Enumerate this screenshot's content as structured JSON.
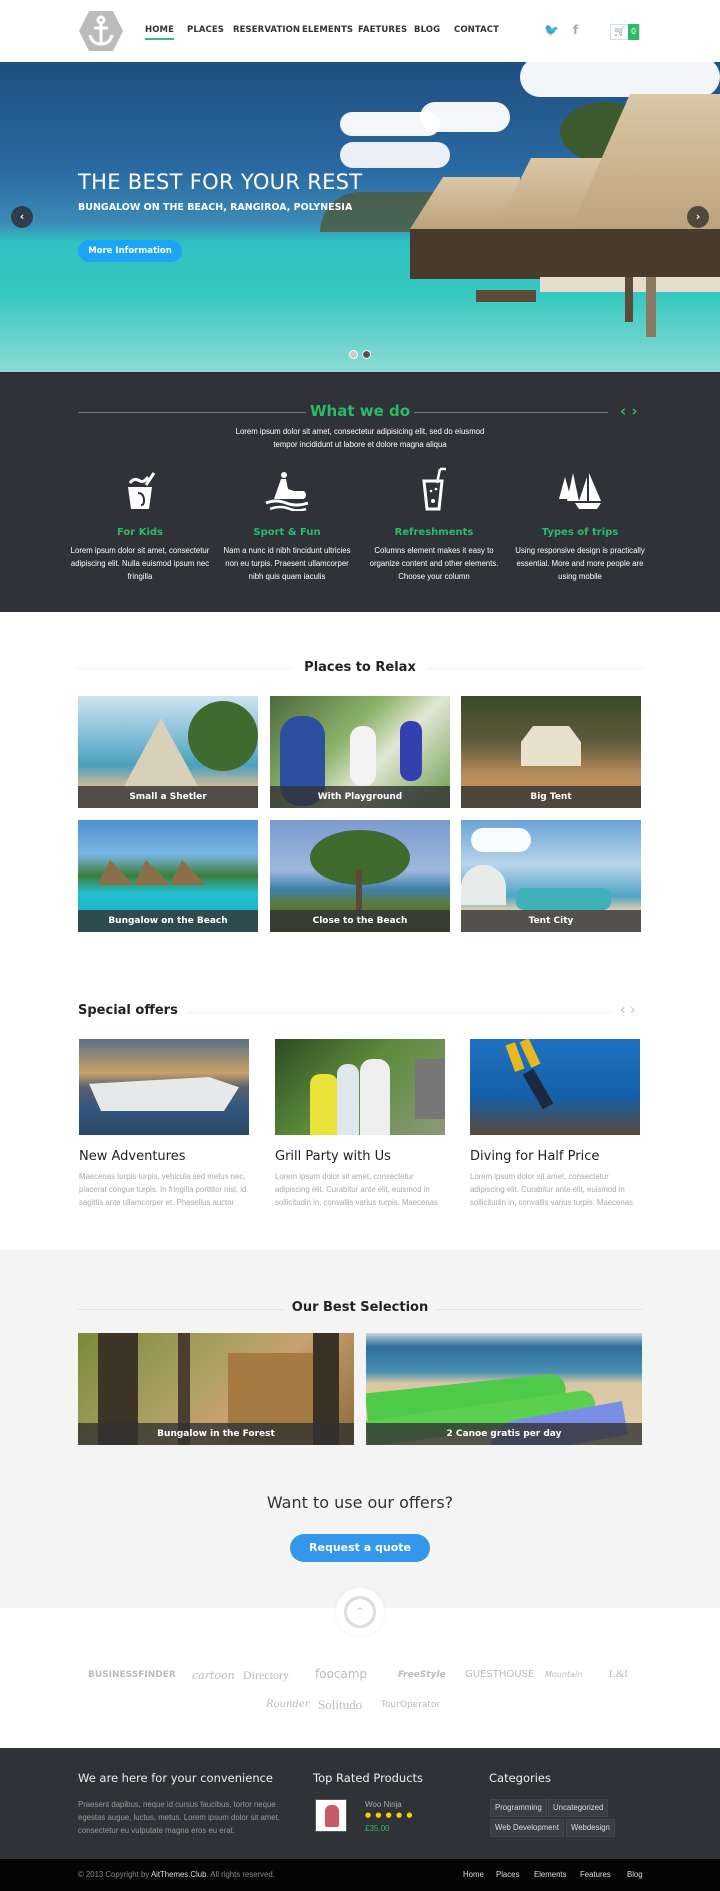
{
  "header": {
    "logo": "anchor-logo",
    "nav": [
      "HOME",
      "PLACES",
      "RESERVATION",
      "ELEMENTS",
      "FAETURES",
      "BLOG",
      "CONTACT"
    ],
    "active_nav": "HOME",
    "social": [
      "twitter",
      "facebook"
    ],
    "cart_count": "0"
  },
  "hero": {
    "title": "THE BEST FOR YOUR REST",
    "subtitle": "BUNGALOW ON THE BEACH, RANGIROA, POLYNESIA",
    "button": "More Information",
    "prev": "‹",
    "next": "›",
    "slides": 2,
    "active_slide": 2
  },
  "what_we_do": {
    "title": "What we do",
    "nav": "‹ ›",
    "description": "Lorem ipsum dolor sit amet, consectetur adipisicing elit, sed do eiusmod tempor incididunt ut labore et dolore magna aliqua",
    "features": [
      {
        "icon": "bucket-icon",
        "title": "For Kids",
        "text": "Lorem ipsum dolor sit amet, consectetur adipiscing elit. Nulla euismod ipsum nec fringilla"
      },
      {
        "icon": "jetski-icon",
        "title": "Sport & Fun",
        "text": "Nam a nunc id nibh tincidunt ultricies non eu turpis. Praesent ullamcorper nibh quis quam iaculis"
      },
      {
        "icon": "drink-icon",
        "title": "Refreshments",
        "text": "Columns element makes it easy to organize content and other elements. Choose your column"
      },
      {
        "icon": "sailboat-icon",
        "title": "Types of trips",
        "text": "Using responsive design is practically essential. More and more people are using mobile"
      }
    ]
  },
  "places": {
    "title": "Places to Relax",
    "items": [
      "Small a Shetler",
      "With Playground",
      "Big Tent",
      "Bungalow on the Beach",
      "Close to the Beach",
      "Tent City"
    ]
  },
  "offers": {
    "title": "Special offers",
    "nav": "‹ ›",
    "items": [
      {
        "title": "New Adventures",
        "text": "Maecenas turpis turpis, vehicula sed metus nec, placerat congue turpis. In fringilla porttitor nisl, id sagittis ante ullamcorper et. Phasellus auctor"
      },
      {
        "title": "Grill Party with Us",
        "text": "Lorem ipsum dolor sit amet, consectetur adipiscing elit. Curabitur ante elit, euismod in sollicitudin in, convallis varius turpis. Maecenas"
      },
      {
        "title": "Diving for Half Price",
        "text": "Lorem ipsum dolor sit amet, consectetur adipiscing elit. Curabitur ante elit, euismod in sollicitudin in, convallis varius turpis. Maecenas"
      }
    ]
  },
  "best": {
    "title": "Our Best Selection",
    "items": [
      "Bungalow in the Forest",
      "2 Canoe gratis per day"
    ],
    "cta_question": "Want to use our offers?",
    "cta_button": "Request a quote",
    "to_top": "^"
  },
  "partners": [
    "BUSINESSFINDER",
    "cartoon",
    "Directory",
    "foocamp",
    "FreeStyle",
    "GUESTHOUSE",
    "Mountain",
    "L&I",
    "Rounder",
    "Solitudo",
    "TourOperator"
  ],
  "footer": {
    "col1_title": "We are here for your convenience",
    "col1_text": "Praesent dapibus, neque id cursus faucibus, tortor neque egestas augue, luctus, metus. Lorem ipsum dolor sit amet, consectetur eu vulputate magna eros eu erat.",
    "col2_title": "Top Rated Products",
    "product_name": "Woo Ninja",
    "product_rating": 5,
    "product_stars": "● ● ● ● ●",
    "product_price": "£35.00",
    "col3_title": "Categories",
    "categories": [
      "Programming",
      "Uncategorized",
      "Web Development",
      "Webdesign"
    ],
    "copyright_pre": "© 2013 Copyright by ",
    "copyright_brand": "AitThemes.Club",
    "copyright_post": ". All rights reserved.",
    "links": [
      "Home",
      "Places",
      "Elements",
      "Features",
      "Blog"
    ]
  },
  "colors": {
    "accent_green": "#2dbb6a",
    "button_blue": "#1ca4f5",
    "cta_blue": "#3597ec",
    "dark": "#2f3337"
  }
}
